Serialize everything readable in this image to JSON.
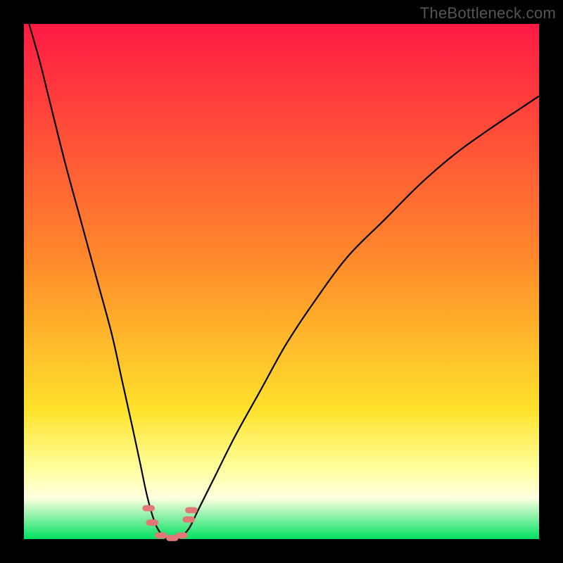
{
  "watermark": "TheBottleneck.com",
  "chart_data": {
    "type": "line",
    "title": "",
    "xlabel": "",
    "ylabel": "",
    "xlim": [
      0,
      100
    ],
    "ylim": [
      0,
      100
    ],
    "grid": false,
    "legend": false,
    "plot_background_gradient": {
      "top": "#ff1a44",
      "mid1": "#ff8a2b",
      "mid2": "#ffe22b",
      "band1": "#ffff9a",
      "band2": "#ffffe0",
      "bottom": "#00e060"
    },
    "series": [
      {
        "name": "left-branch",
        "x": [
          1,
          3,
          5,
          8,
          11,
          14,
          17,
          19,
          21,
          22.5,
          24,
          25.5,
          27,
          28
        ],
        "y": [
          100,
          93,
          85,
          73,
          62,
          51,
          40,
          31,
          22,
          15,
          8,
          3,
          0.5,
          0
        ]
      },
      {
        "name": "right-branch",
        "x": [
          30,
          32,
          34,
          37,
          41,
          46,
          51,
          57,
          63,
          70,
          77,
          84,
          91,
          97,
          100
        ],
        "y": [
          0,
          2,
          6,
          12,
          20,
          29,
          38,
          47,
          55,
          62,
          69,
          75,
          80,
          84,
          86
        ]
      }
    ],
    "optimal_zone": {
      "x_min": 24,
      "x_max": 33,
      "y_max": 4
    },
    "markers": [
      {
        "x": 24.2,
        "y": 6.0
      },
      {
        "x": 24.9,
        "y": 3.2
      },
      {
        "x": 26.6,
        "y": 0.7
      },
      {
        "x": 28.8,
        "y": 0.2
      },
      {
        "x": 30.6,
        "y": 0.7
      },
      {
        "x": 32.0,
        "y": 3.8
      },
      {
        "x": 32.5,
        "y": 5.6
      }
    ],
    "marker_style": {
      "fill": "#e07878",
      "width": 2.4,
      "height": 1.2,
      "rx_ratio": 0.5
    }
  }
}
